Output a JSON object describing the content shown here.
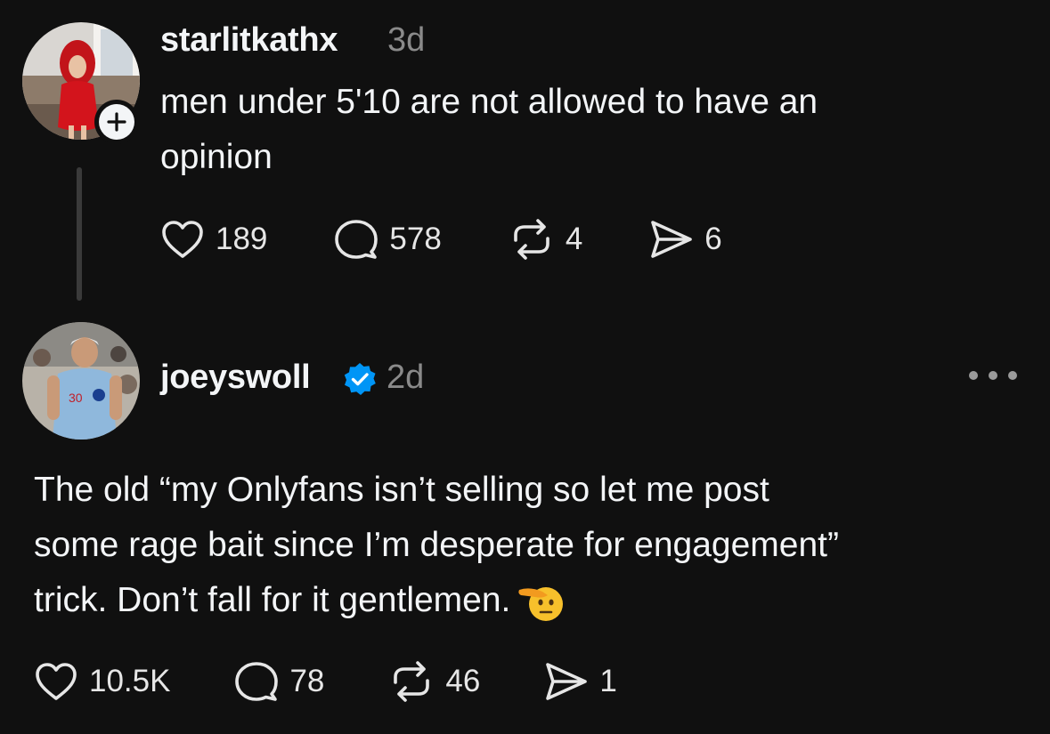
{
  "posts": [
    {
      "username": "starlitkathx",
      "time": "3d",
      "lines": [
        "men under 5'10 are not allowed to have an",
        "opinion"
      ],
      "likes": "189",
      "replies": "578",
      "reposts": "4",
      "shares": "6"
    },
    {
      "username": "joeyswoll",
      "time": "2d",
      "lines": [
        "The old “my Onlyfans isn’t selling so let me post",
        "some rage bait since I’m desperate for engagement”",
        "trick. Don’t fall for it gentlemen."
      ],
      "likes": "10.5K",
      "replies": "78",
      "reposts": "46",
      "shares": "1"
    }
  ],
  "icons": {
    "like": "heart-icon",
    "reply": "speech-bubble-icon",
    "repost": "repost-arrows-icon",
    "share": "send-icon",
    "follow": "plus-icon",
    "verified": "verified-badge-icon",
    "more": "more-options-icon",
    "emoji": "saluting-face-emoji"
  },
  "colors": {
    "background": "#101010",
    "text": "#f3f5f7",
    "muted": "#8a8a8a",
    "verified": "#0095f6"
  }
}
